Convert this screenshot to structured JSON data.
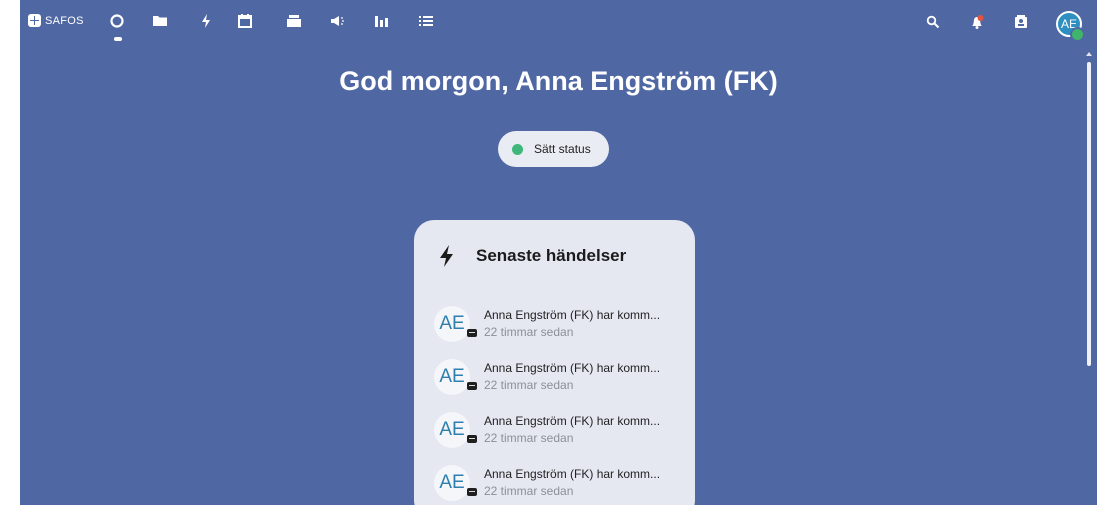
{
  "app": {
    "logo_text": "SAFOS"
  },
  "nav": {
    "icons": [
      "dashboard-icon",
      "folder-icon",
      "activity-icon",
      "calendar-icon",
      "deck-icon",
      "announcement-icon",
      "chart-icon",
      "tasks-icon"
    ]
  },
  "header_right": {
    "icons": [
      "search-icon",
      "notifications-icon",
      "contacts-icon"
    ],
    "avatar_initials": "AE"
  },
  "greeting": "God morgon, Anna Engström (FK)",
  "status": {
    "label": "Sätt status",
    "color": "#40b77a"
  },
  "recent_events": {
    "title": "Senaste händelser",
    "items": [
      {
        "avatar": "AE",
        "text": "Anna Engström (FK) har komm...",
        "time": "22 timmar sedan"
      },
      {
        "avatar": "AE",
        "text": "Anna Engström (FK) har komm...",
        "time": "22 timmar sedan"
      },
      {
        "avatar": "AE",
        "text": "Anna Engström (FK) har komm...",
        "time": "22 timmar sedan"
      },
      {
        "avatar": "AE",
        "text": "Anna Engström (FK) har komm...",
        "time": "22 timmar sedan"
      }
    ]
  },
  "colors": {
    "background": "#4f67a3",
    "card": "#e5e8f1",
    "online": "#3fb46a"
  }
}
